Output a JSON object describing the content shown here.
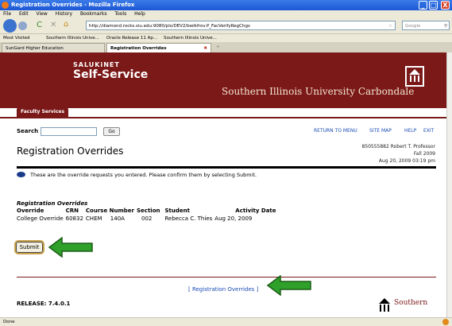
{
  "window": {
    "title": "Registration Overrides - Mozilla Firefox",
    "minimize": "_",
    "maximize": "□",
    "close": "X"
  },
  "menu": [
    "File",
    "Edit",
    "View",
    "History",
    "Bookmarks",
    "Tools",
    "Help"
  ],
  "nav": {
    "url": "http://diamond.rocks.siu.edu:9080/pls/DEV2/bwlkfrov.P_FacVerifyRegChgs",
    "search_placeholder": "Google"
  },
  "bookmarks": [
    "Most Visited",
    "Southern Illinois Unive...",
    "Oracle Release 11 Ap...",
    "Southern Illinois Unive..."
  ],
  "tabs": [
    "SunGard Higher Education",
    "Registration Overrides"
  ],
  "banner": {
    "brand_small": "SALUKiNET",
    "brand_large": "Self-Service",
    "university": "Southern Illinois University Carbondale",
    "faculty_tab": "Faculty Services"
  },
  "page": {
    "search_label": "Search",
    "go_label": "Go",
    "links": [
      "RETURN TO MENU",
      "SITE MAP",
      "HELP",
      "EXIT"
    ],
    "title": "Registration Overrides",
    "user_line": "850555882 Robert T. Professor",
    "term": "Fall 2009",
    "timestamp": "Aug 20, 2009 03:19 pm",
    "info_text": "These are the override requests you entered. Please confirm them by selecting Submit.",
    "table_caption": "Registration Overrides",
    "columns": [
      "Override",
      "CRN",
      "Course Number",
      "Section",
      "Student",
      "Activity Date"
    ],
    "rows": [
      [
        "College Override",
        "60832",
        "CHEM",
        "140A",
        "002",
        "Rebecca C. Thies",
        "Aug 20, 2009"
      ]
    ],
    "submit_label": "Submit",
    "footer_link": "[ Registration Overrides ]",
    "release": "RELEASE: 7.4.0.1",
    "footer_logo": "Southern"
  },
  "status": "Done",
  "colors": {
    "maroon": "#7b1818",
    "arrow_green": "#2fa02a",
    "link_blue": "#1a4cb4"
  }
}
